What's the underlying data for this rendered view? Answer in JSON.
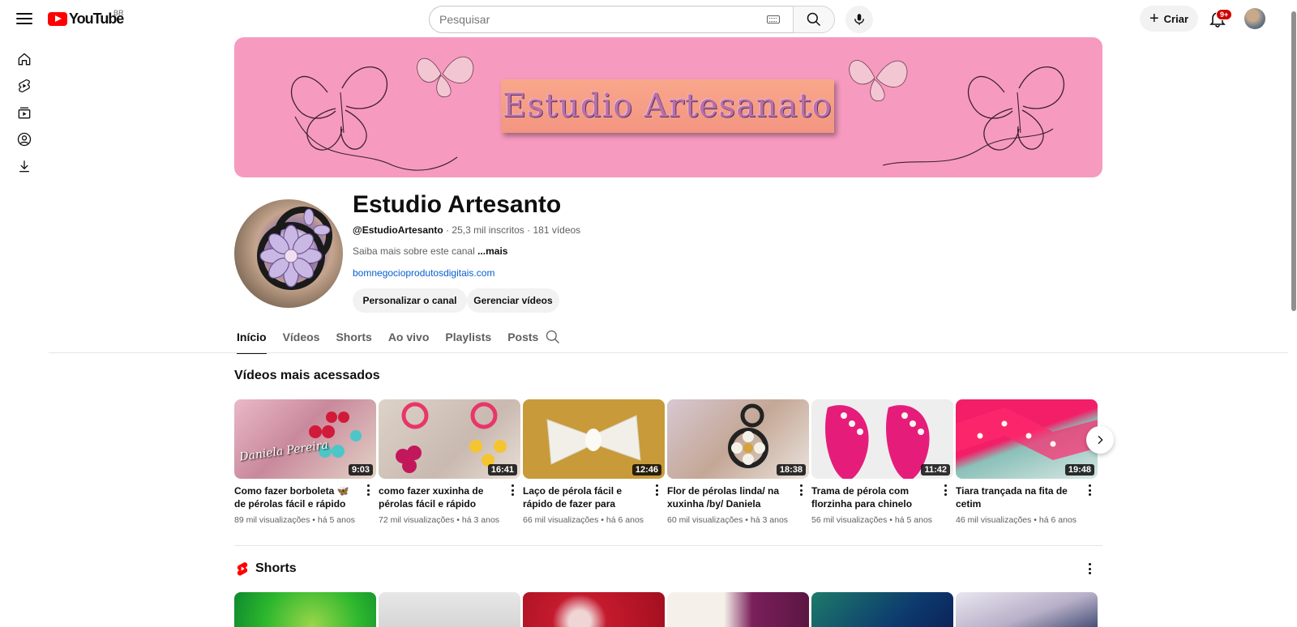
{
  "header": {
    "logo_text": "YouTube",
    "country": "BR",
    "search_placeholder": "Pesquisar",
    "create_label": "Criar",
    "notification_badge": "9+"
  },
  "rail": {
    "items": [
      "home-icon",
      "shorts-icon",
      "subscriptions-icon",
      "you-icon",
      "downloads-icon"
    ]
  },
  "banner": {
    "text": "Estudio Artesanato"
  },
  "channel": {
    "name": "Estudio Artesanto",
    "handle": "@EstudioArtesanto",
    "subscribers": "25,3 mil inscritos",
    "videos_count": "181 vídeos",
    "separator": "·",
    "description": "Saiba mais sobre este canal",
    "more_label": "...mais",
    "link": "bomnegocioprodutosdigitais.com",
    "customize_label": "Personalizar o canal",
    "manage_label": "Gerenciar vídeos"
  },
  "tabs": [
    "Início",
    "Vídeos",
    "Shorts",
    "Ao vivo",
    "Playlists",
    "Posts"
  ],
  "active_tab": "Início",
  "popular": {
    "title": "Vídeos mais acessados",
    "videos": [
      {
        "title": "Como fazer borboleta 🦋de pérolas fácil e rápido para…",
        "duration": "9:03",
        "views": "89 mil visualizações",
        "age": "há 5 anos",
        "overlay": "Daniela Pereira"
      },
      {
        "title": "como fazer xuxinha de pérolas fácil e rápido /by/…",
        "duration": "16:41",
        "views": "72 mil visualizações",
        "age": "há 3 anos"
      },
      {
        "title": "Laço de pérola fácil e rápido de fazer para iniciantes",
        "duration": "12:46",
        "views": "66 mil visualizações",
        "age": "há 6 anos"
      },
      {
        "title": "Flor de pérolas linda/ na xuxinha /by/ Daniela pereira",
        "duration": "18:38",
        "views": "60 mil visualizações",
        "age": "há 3 anos"
      },
      {
        "title": "Trama de pérola com florzinha para chinelo infant…",
        "duration": "11:42",
        "views": "56 mil visualizações",
        "age": "há 5 anos"
      },
      {
        "title": "Tiara trançada na fita de cetim",
        "duration": "19:48",
        "views": "46 mil visualizações",
        "age": "há 6 anos"
      }
    ],
    "meta_separator": "•"
  },
  "shorts": {
    "title": "Shorts"
  },
  "colors": {
    "brand_red": "#ff0000",
    "link_blue": "#065fd4",
    "banner_pink": "#f79ac0"
  }
}
